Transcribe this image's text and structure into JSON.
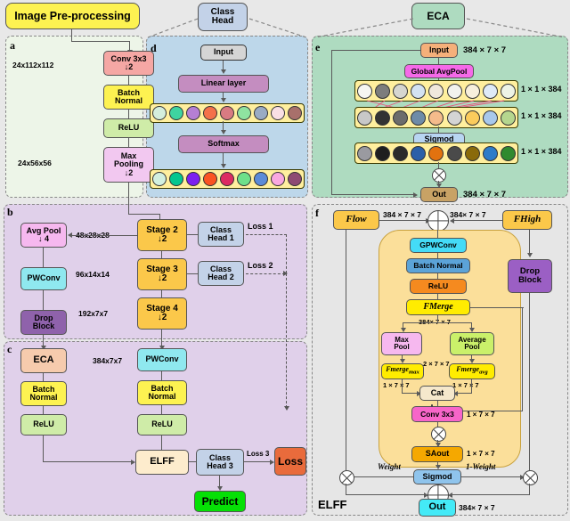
{
  "figure": {
    "title_box": "Image Pre-processing",
    "panels": [
      "a",
      "b",
      "c",
      "d",
      "e",
      "f"
    ]
  },
  "panel_a": {
    "letter": "a",
    "dims": [
      "24x112x112",
      "24x56x56"
    ],
    "nodes": [
      {
        "label": "Conv 3x3",
        "sub": "↓2",
        "color": "#f5a7a4"
      },
      {
        "label": "Batch",
        "sub": "Normal",
        "color": "#fdf251"
      },
      {
        "label": "ReLU",
        "sub": "",
        "color": "#cfeca8"
      },
      {
        "label": "Max",
        "sub": "Pooling",
        "sub2": "↓2",
        "color": "#f2c8f0"
      }
    ]
  },
  "panel_b": {
    "letter": "b",
    "left_nodes": [
      {
        "label": "Avg Pool",
        "sub": "↓ 4",
        "color": "#f6b8ef"
      },
      {
        "label": "PWConv",
        "sub": "",
        "color": "#8fe8ef"
      },
      {
        "label": "Drop",
        "sub": "Block",
        "color": "#8f62ab"
      }
    ],
    "stages": [
      {
        "label": "Stage 2",
        "sub": "↓2",
        "color": "#fbc84a",
        "dim": "48x28x28",
        "head": "Class\nHead 1",
        "loss": "Loss 1"
      },
      {
        "label": "Stage 3",
        "sub": "↓2",
        "color": "#fbc84a",
        "dim": "96x14x14",
        "head": "Class\nHead 2",
        "loss": "Loss 2"
      },
      {
        "label": "Stage 4",
        "sub": "↓2",
        "color": "#fbc84a",
        "dim": "192x7x7",
        "head": "",
        "loss": ""
      }
    ],
    "head_labels": [
      {
        "l1": "Class",
        "l2": "Head 1"
      },
      {
        "l1": "Class",
        "l2": "Head 2"
      }
    ],
    "loss_labels": [
      "Loss 1",
      "Loss 2"
    ]
  },
  "panel_c": {
    "letter": "c",
    "left_chain": [
      {
        "label": "ECA",
        "sub": "",
        "color": "#f6cbad"
      },
      {
        "label": "Batch",
        "sub": "Normal",
        "color": "#fdf251"
      },
      {
        "label": "ReLU",
        "sub": "",
        "color": "#cfeca8"
      }
    ],
    "right_chain": [
      {
        "label": "PWConv",
        "sub": "",
        "color": "#8fe8ef"
      },
      {
        "label": "Batch",
        "sub": "Normal",
        "color": "#fdf251"
      },
      {
        "label": "ReLU",
        "sub": "",
        "color": "#cfeca8"
      }
    ],
    "dim": "384x7x7",
    "elff": {
      "label": "ELFF",
      "color": "#fdeccd"
    },
    "class_head": {
      "l1": "Class",
      "l2": "Head 3",
      "color": "#c3d2e8"
    },
    "loss_label": "Loss 3",
    "loss_box": {
      "label": "Loss",
      "color": "#e96b3c"
    },
    "predict": {
      "label": "Predict",
      "color": "#06e006"
    }
  },
  "panel_d": {
    "letter": "d",
    "title": "Class\nHead",
    "title_l1": "Class",
    "title_l2": "Head",
    "nodes": [
      {
        "label": "Input",
        "color": "#d5d5d5"
      },
      {
        "label": "Linear layer",
        "color": "#c48dc0"
      },
      {
        "label": "Softmax",
        "color": "#c48dc0"
      }
    ],
    "row1_colors": [
      "#d4eedd",
      "#3fd4a0",
      "#b57fd4",
      "#f4714a",
      "#d97b82",
      "#8fe3a0",
      "#9aabc4",
      "#f9dfe4",
      "#a8706b"
    ],
    "row2_colors": [
      "#d2f0e0",
      "#04c68f",
      "#7c1ff0",
      "#fb5322",
      "#dc2a62",
      "#6ee08a",
      "#5b8bd8",
      "#f9a8e0",
      "#8e4a73"
    ]
  },
  "panel_e": {
    "letter": "e",
    "title": "ECA",
    "nodes": [
      {
        "label": "Input",
        "color": "#f5b07a"
      },
      {
        "label": "Global AvgPool",
        "color": "#f569e8"
      },
      {
        "label": "Sigmod",
        "color": "#b8d5f2"
      },
      {
        "label": "Out",
        "color": "#c8a265"
      }
    ],
    "dims_io": [
      "384 × 7 × 7",
      "384 × 7 × 7"
    ],
    "dims_rows": [
      "1 × 1 × 384",
      "1 × 1 × 384",
      "1 × 1 × 384"
    ],
    "row1_colors": [
      "#f6f6f2",
      "#7d7d7d",
      "#d6d6d0",
      "#d3e2f2",
      "#f0e8dc",
      "#f2f2ee",
      "#f7efdc",
      "#dfeaf7",
      "#eef4e6"
    ],
    "row2_colors": [
      "#c8c8c8",
      "#333333",
      "#6c6c6c",
      "#6e8ba8",
      "#f5bb8b",
      "#d4d4d4",
      "#fbcc5c",
      "#a8c8ec",
      "#b5d68e"
    ],
    "row3_colors": [
      "#9a9aa0",
      "#1e1e1e",
      "#2b2b2b",
      "#2a5fa8",
      "#e2720f",
      "#4a4a4a",
      "#8a6a0a",
      "#2f7cc8",
      "#2f8a2f"
    ]
  },
  "panel_f": {
    "letter": "f",
    "module_name": "ELFF",
    "inputs": [
      {
        "label": "Flow",
        "color": "#fbc84a",
        "dim": "384 × 7 × 7"
      },
      {
        "label": "FHigh",
        "color": "#fbc84a",
        "dim": "384× 7 × 7"
      }
    ],
    "chain": [
      {
        "label": "GPWConv",
        "color": "#44dbf7"
      },
      {
        "label": "Batch Normal",
        "color": "#5ba3d8"
      },
      {
        "label": "ReLU",
        "color": "#f58a1f"
      },
      {
        "label": "FMerge",
        "color": "#ffec00",
        "italic": true
      }
    ],
    "merge_dim": "384× 7 × 7",
    "pools": [
      {
        "l1": "Max",
        "l2": "Pool",
        "color": "#f6b8ef",
        "out": "Fmerge",
        "sub": "max",
        "dim": "1 × 7 × 7"
      },
      {
        "l1": "Average",
        "l2": "Pool",
        "color": "#caf06a",
        "out": "Fmerge",
        "sub": "avg",
        "dim": "1 × 7 × 7"
      }
    ],
    "cat": {
      "label": "Cat",
      "color": "#f5e8cc",
      "dim": "2 × 7 × 7"
    },
    "conv": {
      "label": "Conv 3x3",
      "color": "#f765c9",
      "dim": "1 × 7 × 7"
    },
    "saout": {
      "label": "SAout",
      "color": "#f5a800",
      "dim": "1 × 7 × 7"
    },
    "sigmod": {
      "label": "Sigmod",
      "color": "#8fc4ec"
    },
    "dropblock": {
      "l1": "Drop",
      "l2": "Block",
      "color": "#9b5fc4"
    },
    "weight_labels": [
      "Weight",
      "1-Weight"
    ],
    "out": {
      "label": "Out",
      "color": "#44eaf7",
      "dim": "384× 7 × 7"
    }
  }
}
